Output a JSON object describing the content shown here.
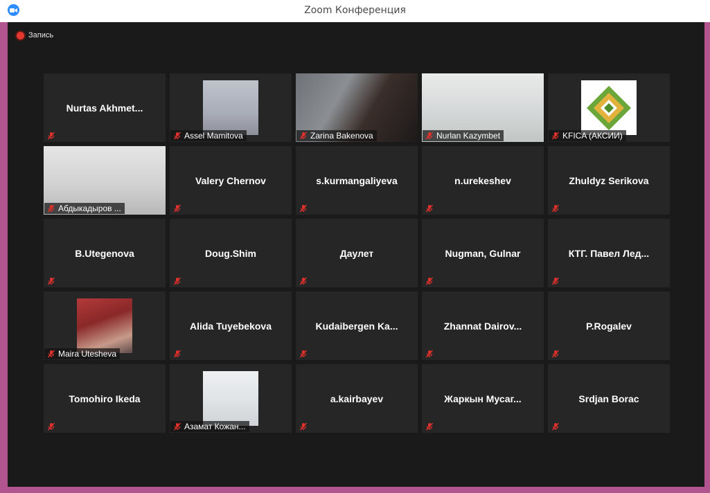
{
  "window": {
    "title": "Zoom Конференция",
    "app_icon": "zoom-camera-icon",
    "accent": "#2d8cff",
    "frame_color": "#b2548f"
  },
  "recording": {
    "label": "Запись",
    "icon": "record-icon",
    "color": "#e4372e"
  },
  "participants": [
    {
      "name": "Nurtas  Akhmet...",
      "mode": "name"
    },
    {
      "name": "Assel Mamitova",
      "mode": "photo",
      "photo": "p-assel"
    },
    {
      "name": "Zarina Bakenova",
      "mode": "video",
      "video": "v-zarina"
    },
    {
      "name": "Nurlan Kazymbet",
      "mode": "video",
      "video": "v-nurlan",
      "active": true
    },
    {
      "name": "KFICA (АКСИИ)",
      "mode": "photo",
      "photo": "p-kfica"
    },
    {
      "name": "Абдыкадыров ...",
      "mode": "video",
      "video": "v-abd"
    },
    {
      "name": "Valery Chernov",
      "mode": "name"
    },
    {
      "name": "s.kurmangaliyeva",
      "mode": "name"
    },
    {
      "name": "n.urekeshev",
      "mode": "name"
    },
    {
      "name": "Zhuldyz Serikova",
      "mode": "name"
    },
    {
      "name": "B.Utegenova",
      "mode": "name"
    },
    {
      "name": "Doug.Shim",
      "mode": "name"
    },
    {
      "name": "Даулет",
      "mode": "name"
    },
    {
      "name": "Nugman, Gulnar",
      "mode": "name"
    },
    {
      "name": "КТГ. Павел Лед...",
      "mode": "name"
    },
    {
      "name": "Maira Utesheva",
      "mode": "photo",
      "photo": "p-maira"
    },
    {
      "name": "Alida Tuyebekova",
      "mode": "name"
    },
    {
      "name": "Kudaibergen  Ka...",
      "mode": "name"
    },
    {
      "name": "Zhannat  Dairov...",
      "mode": "name"
    },
    {
      "name": "P.Rogalev",
      "mode": "name"
    },
    {
      "name": "Tomohiro Ikeda",
      "mode": "name"
    },
    {
      "name": "Азамат Кожан...",
      "mode": "photo",
      "photo": "p-azamat"
    },
    {
      "name": "a.kairbayev",
      "mode": "name"
    },
    {
      "name": "Жаркын  Мусаг...",
      "mode": "name"
    },
    {
      "name": "Srdjan Borac",
      "mode": "name"
    }
  ],
  "icons": {
    "muted": "muted-microphone-icon",
    "muted_color": "#e0312c"
  },
  "highlight_color": "#c7e23a"
}
